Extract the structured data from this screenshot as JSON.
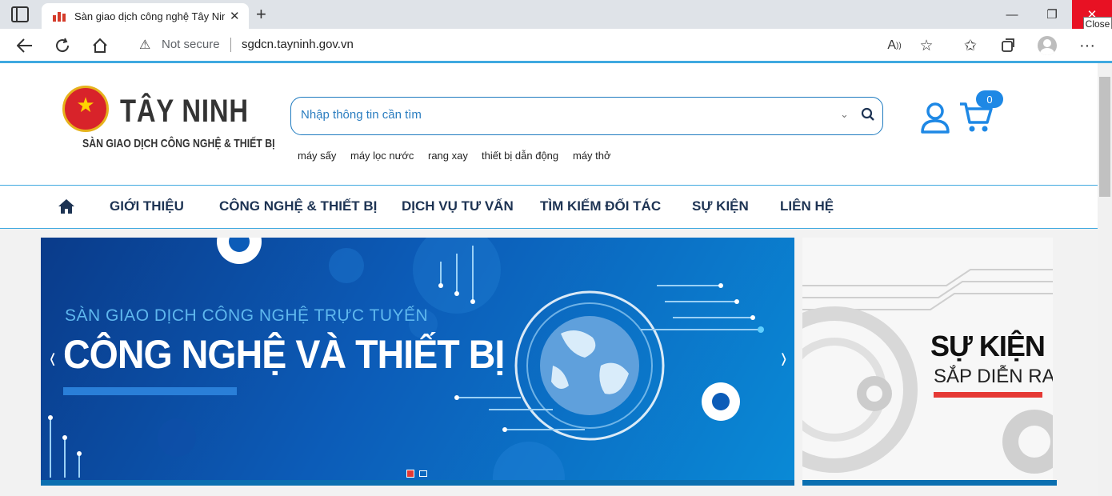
{
  "browser": {
    "tab_title": "Sàn giao dịch công nghệ Tây Ninh",
    "close_tooltip": "Close",
    "address_warning": "Not secure",
    "url": "sgdcn.tayninh.gov.vn"
  },
  "header": {
    "logo_title": "TÂY NINH",
    "logo_subtitle": "SÀN GIAO DỊCH CÔNG NGHỆ & THIẾT BỊ",
    "search_placeholder": "Nhập thông tin cần tìm",
    "keywords": [
      "máy sấy",
      "máy lọc nước",
      "rang xay",
      "thiết bị dẫn động",
      "máy thở"
    ],
    "cart_count": "0"
  },
  "nav": {
    "items": [
      "GIỚI THIỆU",
      "CÔNG NGHỆ & THIẾT BỊ",
      "DỊCH VỤ TƯ VẤN",
      "TÌM KIẾM ĐỐI TÁC",
      "SỰ KIỆN",
      "LIÊN HỆ"
    ]
  },
  "banner": {
    "subtitle": "SÀN GIAO DỊCH CÔNG NGHỆ TRỰC TUYẾN",
    "title": "CÔNG NGHỆ VÀ THIẾT BỊ",
    "prev": "‹",
    "next": "›"
  },
  "side_banner": {
    "title": "SỰ KIỆN",
    "subtitle": "SẮP DIỄN RA"
  },
  "colors": {
    "accent": "#3fa9e0",
    "nav_text": "#1d3353",
    "close_red": "#e81123"
  }
}
